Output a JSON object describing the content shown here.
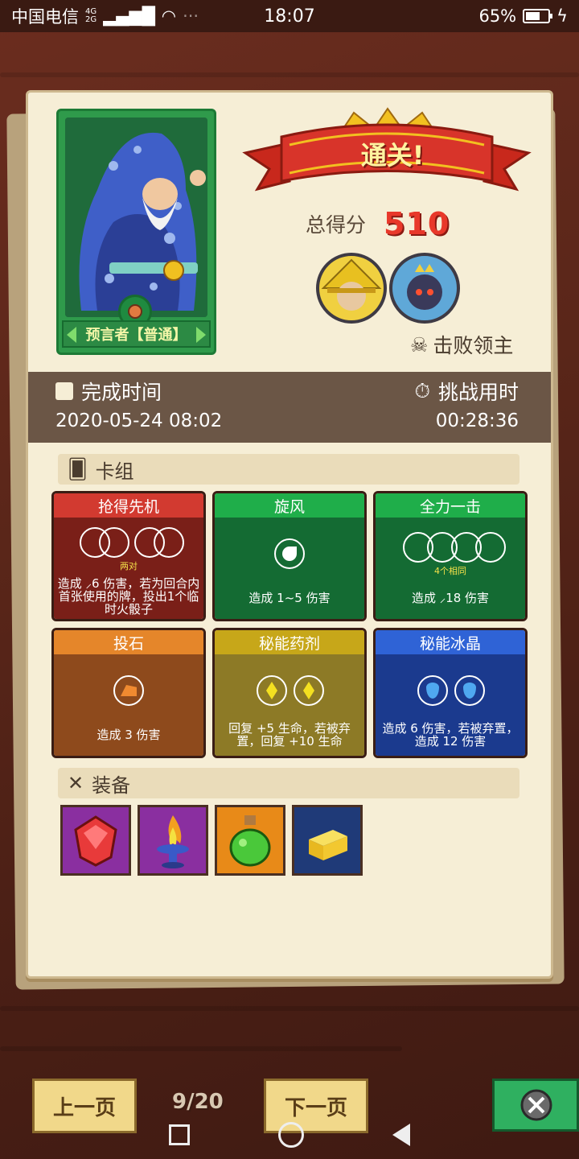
{
  "status_bar": {
    "carrier": "中国电信",
    "signal_top": "4G",
    "signal_bottom": "2G",
    "time": "18:07",
    "battery": "65%",
    "battery_level": 0.65
  },
  "hero": {
    "name": "预言者【普通】"
  },
  "result": {
    "banner": "通关!",
    "score_label": "总得分",
    "score_value": "510",
    "defeat_label": "击败领主"
  },
  "times": {
    "finish_label": "完成时间",
    "finish_value": "2020-05-24 08:02",
    "duration_label": "挑战用时",
    "duration_value": "00:28:36"
  },
  "deck": {
    "title": "卡组",
    "cards": [
      {
        "name": "抢得先机",
        "sub": "两对",
        "desc": "造成 ⸝6 伤害，若为回合内首张使用的牌，投出1个临时火骰子",
        "color": "red"
      },
      {
        "name": "旋风",
        "desc": "造成 1~5 伤害",
        "color": "green"
      },
      {
        "name": "全力一击",
        "sub": "4个相同",
        "desc": "造成 ⸝18 伤害",
        "color": "green"
      },
      {
        "name": "投石",
        "desc": "造成 3 伤害",
        "color": "orange"
      },
      {
        "name": "秘能药剂",
        "desc": "回复 +5 生命，若被弃置，回复 +10 生命",
        "color": "olive"
      },
      {
        "name": "秘能冰晶",
        "desc": "造成 6 伤害，若被弃置，造成 12 伤害",
        "color": "blue"
      }
    ]
  },
  "equipment": {
    "title": "装备",
    "items": [
      "ruby-gem",
      "fire-brazier",
      "green-potion",
      "gold-bars"
    ]
  },
  "nav": {
    "prev": "上一页",
    "page": "9/20",
    "next": "下一页"
  }
}
